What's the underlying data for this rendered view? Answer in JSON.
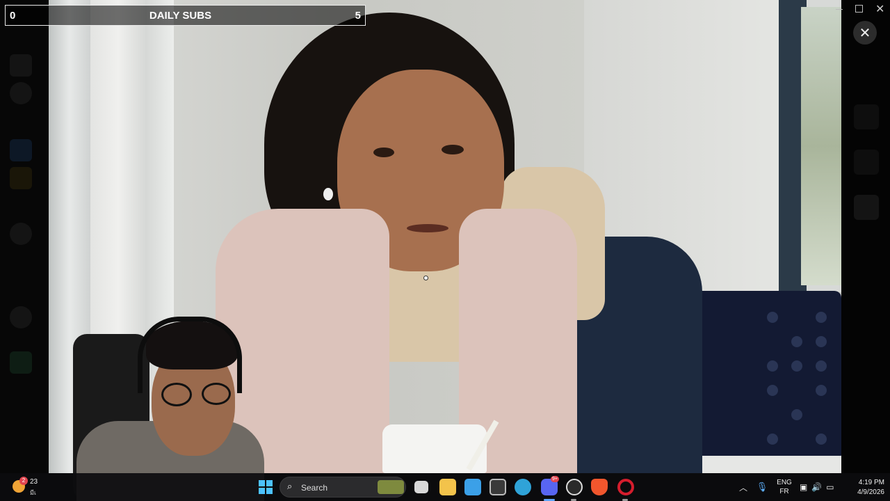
{
  "subscriber_goal": {
    "current": "0",
    "title": "DAILY SUBS",
    "target": "5"
  },
  "window_controls": {
    "minimize_icon": "minimize-icon",
    "maximize_icon": "maximize-icon",
    "close_icon": "close-icon",
    "close_glyph": "✕",
    "player_close_glyph": "✕"
  },
  "video": {
    "description_icon": "video-frame",
    "cursor_icon": "cursor-dot-icon"
  },
  "taskbar": {
    "weather": {
      "badge": "2",
      "temperature": "23",
      "condition": "มีเ"
    },
    "search": {
      "label": "Search",
      "icon_glyph": "⌕"
    },
    "apps": [
      {
        "name": "task-view",
        "color": "#d8d8d8"
      },
      {
        "name": "file-explorer",
        "color": "#f3c34b"
      },
      {
        "name": "microsoft-store",
        "color": "#3ba0e8"
      },
      {
        "name": "unity",
        "color": "#3a3a3a"
      },
      {
        "name": "edge",
        "color": "#2fa3d8"
      },
      {
        "name": "discord",
        "color": "#5865f2",
        "badge": "9+"
      },
      {
        "name": "obs",
        "color": "#2a2a2a"
      },
      {
        "name": "brave",
        "color": "#f1562d"
      },
      {
        "name": "opera",
        "color": "#d51d2d"
      }
    ],
    "tray": {
      "chevron_glyph": "︿",
      "mic_glyph": "🎙",
      "language_primary": "ENG",
      "language_secondary": "FR",
      "network_glyph": "▣",
      "volume_glyph": "🔊",
      "battery_glyph": "▭"
    },
    "clock": {
      "time": "4:19 PM",
      "date": "4/9/2026"
    }
  },
  "colors": {
    "goal_border": "#e9e9e9",
    "taskbar_bg": "#0c0c0e",
    "accent_blue": "#4cc2ff"
  }
}
